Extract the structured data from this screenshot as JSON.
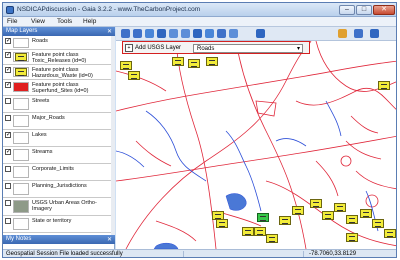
{
  "window": {
    "title": "NSDICAPdiscussion - Gaia 3.2.2 - www.TheCarbonProject.com",
    "minimize": "–",
    "maximize": "□",
    "close": "✕"
  },
  "menu": [
    "File",
    "View",
    "Tools",
    "Help"
  ],
  "map_layers_panel": {
    "title": "Map Layers",
    "pin": "✕",
    "layers": [
      {
        "label": "Roads",
        "checked": true
      },
      {
        "label": "Feature point class Toxic_Releases (id=0)",
        "checked": true
      },
      {
        "label": "Feature point class Hazardous_Waste (id=0)",
        "checked": true
      },
      {
        "label": "Feature point class Superfund_Sites (id=0)",
        "checked": true
      },
      {
        "label": "Streets",
        "checked": false
      },
      {
        "label": "Major_Roads",
        "checked": false
      },
      {
        "label": "Lakes",
        "checked": true
      },
      {
        "label": "Streams",
        "checked": true
      },
      {
        "label": "Corporate_Limits",
        "checked": false
      },
      {
        "label": "Planning_Jurisdictions",
        "checked": false
      },
      {
        "label": "USGS Urban Areas Ortho-Imagery",
        "checked": false
      },
      {
        "label": "State or territory",
        "checked": false
      }
    ],
    "check_mark": "✓",
    "footer": "My Notes",
    "footer_pin": "✕"
  },
  "toolbar": {
    "icons": [
      "zoom-in-icon",
      "zoom-out-icon",
      "zoom-box-icon",
      "pan-icon",
      "back-icon",
      "forward-icon",
      "refresh-icon",
      "full-extent-icon",
      "select-icon",
      "layers-icon",
      "info-icon",
      "pencil-icon",
      "measure-icon",
      "save-icon"
    ]
  },
  "layer_bar": {
    "icon": "+",
    "label": "Add USGS Layer",
    "selected": "Roads",
    "caret": "▾"
  },
  "statusbar": {
    "message": "Geospatial Session File loaded successfully",
    "coords": "-78.7060,33.8129"
  },
  "colors": {
    "roads": "#e0283b",
    "streams": "#2d4fd8",
    "lakes": "#4a78d6",
    "marker": "#f2ec3a",
    "superfund": "#37c84a",
    "accent": "#d42020"
  }
}
